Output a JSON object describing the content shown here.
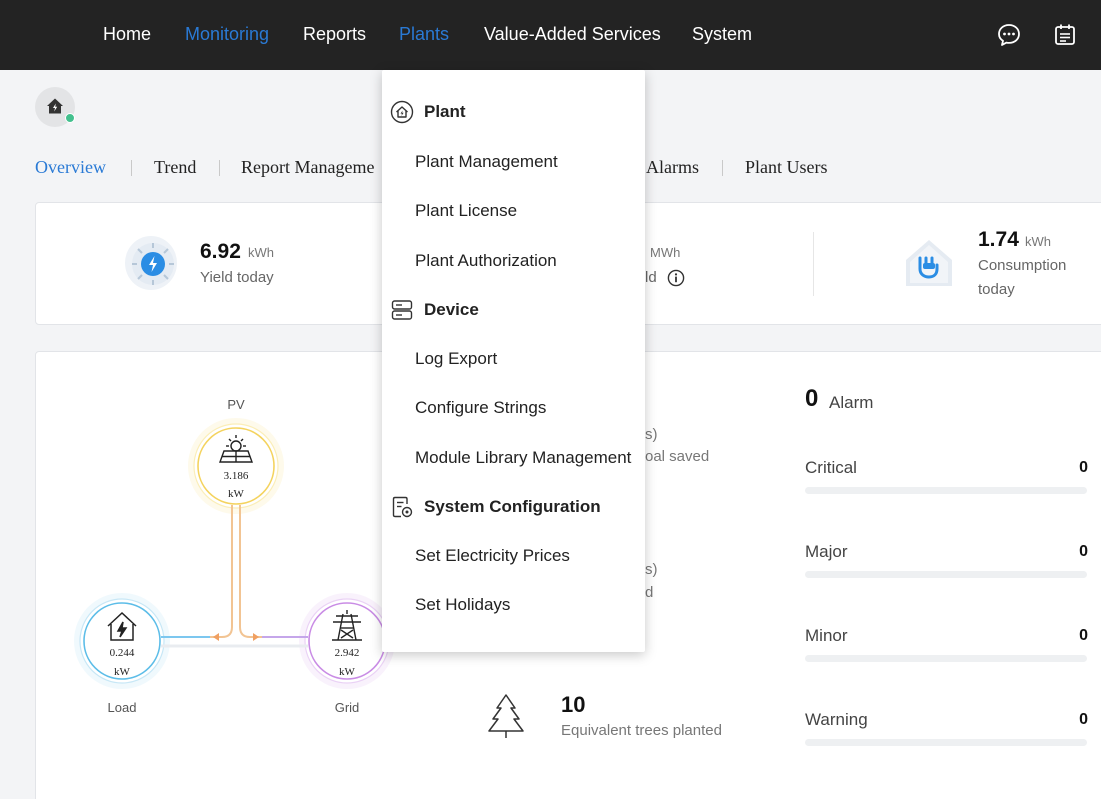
{
  "nav": {
    "items": [
      {
        "label": "Home"
      },
      {
        "label": "Monitoring"
      },
      {
        "label": "Reports"
      },
      {
        "label": "Plants"
      },
      {
        "label": "Value-Added Services"
      },
      {
        "label": "System"
      }
    ],
    "active_color": "#2a7ad5"
  },
  "subtabs": {
    "items": [
      {
        "label": "Overview"
      },
      {
        "label": "Trend"
      },
      {
        "label": "Report Manageme"
      },
      {
        "label": "Alarms"
      },
      {
        "label": "Plant Users"
      }
    ]
  },
  "stats": {
    "yield_today": {
      "value": "6.92",
      "unit": "kWh",
      "label": "Yield today"
    },
    "total_yield": {
      "unit": "MWh",
      "label": "ld"
    },
    "consumption_today": {
      "value": "1.74",
      "unit": "kWh",
      "label_line1": "Consumption",
      "label_line2": "today"
    }
  },
  "flow": {
    "pv": {
      "label": "PV",
      "value": "3.186",
      "unit": "kW"
    },
    "load": {
      "label": "Load",
      "value": "0.244",
      "unit": "kW"
    },
    "grid": {
      "label": "Grid",
      "value": "2.942",
      "unit": "kW"
    }
  },
  "environment": {
    "partial_1": "s)",
    "partial_2": "oal saved",
    "partial_3": "s)",
    "partial_4": "d",
    "trees_value": "10",
    "trees_label": "Equivalent trees planted"
  },
  "alarms": {
    "count": "0",
    "title": "Alarm",
    "levels": [
      {
        "name": "Critical",
        "value": "0"
      },
      {
        "name": "Major",
        "value": "0"
      },
      {
        "name": "Minor",
        "value": "0"
      },
      {
        "name": "Warning",
        "value": "0"
      }
    ]
  },
  "dropdown": {
    "sections": [
      {
        "label": "Plant",
        "icon": "plant-house-icon"
      },
      {
        "label": "Device",
        "icon": "device-server-icon"
      },
      {
        "label": "System Configuration",
        "icon": "system-config-icon"
      }
    ],
    "items": [
      {
        "label": "Plant Management"
      },
      {
        "label": "Plant License"
      },
      {
        "label": "Plant Authorization"
      },
      {
        "label": "Log Export"
      },
      {
        "label": "Configure Strings"
      },
      {
        "label": "Module Library Management"
      },
      {
        "label": "Set Electricity Prices"
      },
      {
        "label": "Set Holidays"
      }
    ]
  }
}
